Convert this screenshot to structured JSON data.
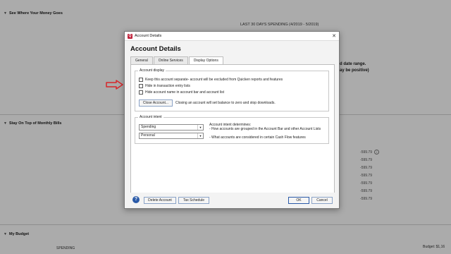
{
  "background": {
    "section1_title": "See Where Your Money Goes",
    "spending_header": "LAST 30 DAYS SPENDING (4/2019 - 5/2019)",
    "date_range_text": "d date range.",
    "positive_text": "ay be positive)",
    "section2_title": "Stay On Top of Monthly Bills",
    "amounts": [
      "-599.79",
      "-599.79",
      "-599.79",
      "-599.79",
      "-599.79",
      "-599.79",
      "-599.79"
    ],
    "section3_title": "My Budget",
    "spending_label": "SPENDING",
    "budget_text": "Budget: $1,16",
    "info_icon_glyph": "i"
  },
  "dialog": {
    "window_title": "Account Details",
    "heading": "Account Details",
    "close_glyph": "✕",
    "tabs": [
      {
        "label": "General"
      },
      {
        "label": "Online Services"
      },
      {
        "label": "Display Options"
      }
    ],
    "account_display": {
      "title": "Account display",
      "options": [
        {
          "label": "Keep this account separate- account will be excluded from Quicken reports and features",
          "checked": false
        },
        {
          "label": "Hide in transaction entry lists",
          "checked": false
        },
        {
          "label": "Hide account name in account bar and account list",
          "checked": false
        }
      ],
      "close_button": "Close Account...",
      "close_note": "Closing an account will set balance to zero and stop downloads."
    },
    "account_intent": {
      "title": "Account intent",
      "select1": "Spending",
      "select2": "Personal",
      "determines_title": "Account intent determines:",
      "line1": "- How accounts are grouped in the Account Bar and other Account Lists",
      "line2": "- What accounts are considered in certain Cash Flow features"
    },
    "footer": {
      "help_glyph": "?",
      "delete_button": "Delete Account",
      "tax_button": "Tax Schedule",
      "ok_button": "OK",
      "cancel_button": "Cancel"
    }
  },
  "colors": {
    "annotation_arrow": "#d7262b",
    "title_icon": "#c0213a",
    "help_icon": "#2a5aa8"
  }
}
